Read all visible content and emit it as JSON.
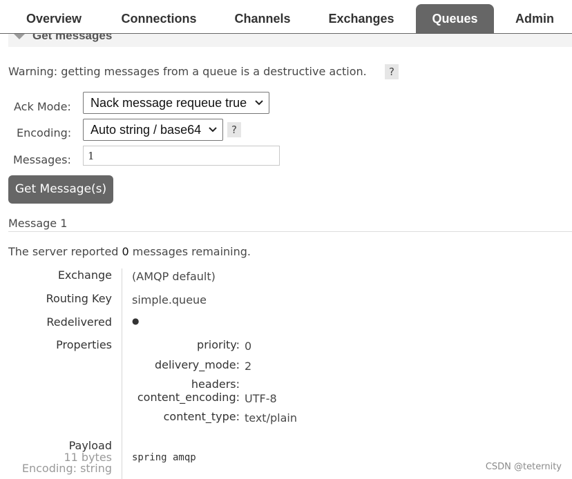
{
  "tabs": [
    {
      "label": "Overview"
    },
    {
      "label": "Connections"
    },
    {
      "label": "Channels"
    },
    {
      "label": "Exchanges"
    },
    {
      "label": "Queues",
      "active": true
    },
    {
      "label": "Admin"
    }
  ],
  "section": {
    "title": "Get messages"
  },
  "warning": {
    "text": "Warning: getting messages from a queue is a destructive action.",
    "help": "?"
  },
  "form": {
    "ack_mode_label": "Ack Mode:",
    "ack_mode_value": "Nack message requeue true",
    "encoding_label": "Encoding:",
    "encoding_value": "Auto string / base64",
    "encoding_help": "?",
    "messages_label": "Messages:",
    "messages_value": "1",
    "get_button": "Get Message(s)"
  },
  "result": {
    "message_heading": "Message 1",
    "remaining_prefix": "The server reported ",
    "remaining_count": "0",
    "remaining_suffix": " messages remaining."
  },
  "details": {
    "exchange_label": "Exchange",
    "exchange_value": "(AMQP default)",
    "routing_key_label": "Routing Key",
    "routing_key_value": "simple.queue",
    "redelivered_label": "Redelivered",
    "redelivered_value": "●",
    "properties_label": "Properties",
    "properties": {
      "priority_key": "priority:",
      "priority_value": "0",
      "delivery_mode_key": "delivery_mode:",
      "delivery_mode_value": "2",
      "headers_key": "headers:",
      "content_encoding_key": "content_encoding:",
      "content_encoding_value": "UTF-8",
      "content_type_key": "content_type:",
      "content_type_value": "text/plain"
    },
    "payload_label": "Payload",
    "payload_size": "11 bytes",
    "payload_encoding": "Encoding: string",
    "payload_value": "spring amqp"
  },
  "watermark": "CSDN @teternity"
}
